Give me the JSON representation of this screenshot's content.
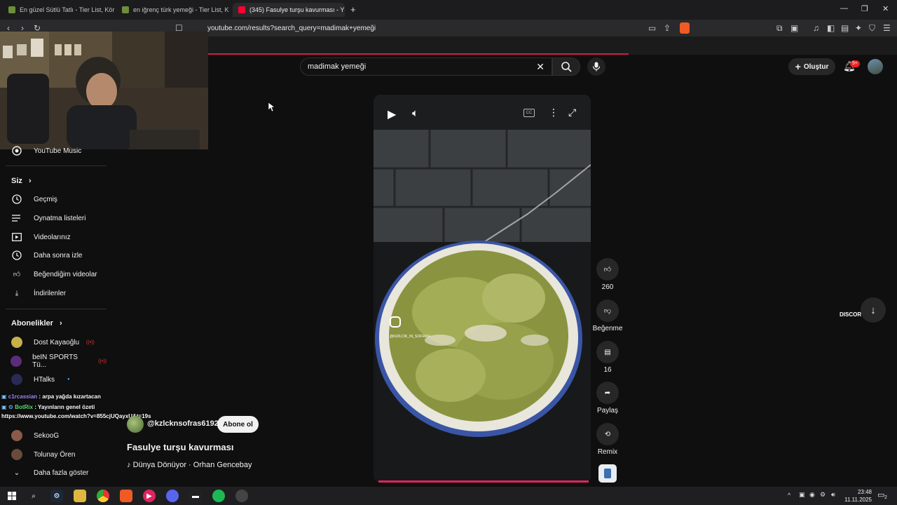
{
  "browser": {
    "tabs": [
      {
        "title": "En güzel Sütlü Tatlı - Tier List, Kör Sır"
      },
      {
        "title": "en iğrenç türk yemeği - Tier List, Kör"
      },
      {
        "title": "(345) Fasulye turşu kavurması - Y"
      }
    ],
    "url": "youtube.com/results?search_query=madimak+yemeği"
  },
  "youtube": {
    "search_value": "madimak yemeği",
    "create_label": "Oluştur",
    "notif_badge": "9+"
  },
  "sidebar": {
    "music_label": "YouTube Music",
    "you_section": "Siz",
    "you_items": [
      {
        "label": "Geçmiş",
        "icon": "history-icon"
      },
      {
        "label": "Oynatma listeleri",
        "icon": "playlist-icon"
      },
      {
        "label": "Videolarınız",
        "icon": "your-videos-icon"
      },
      {
        "label": "Daha sonra izle",
        "icon": "watch-later-icon"
      },
      {
        "label": "Beğendiğim videolar",
        "icon": "thumbs-up-icon"
      },
      {
        "label": "İndirilenler",
        "icon": "download-icon"
      }
    ],
    "subs_section": "Abonelikler",
    "subs": [
      {
        "label": "Dost Kayaoğlu",
        "color": "#c7b24a"
      },
      {
        "label": "beIN SPORTS Tü...",
        "color": "#5a2d7a"
      },
      {
        "label": "HTalks",
        "color": "#2a2a55"
      },
      {
        "label": "SekooG",
        "color": "#8a5a4a"
      },
      {
        "label": "Tolunay Ören",
        "color": "#6a4a3a"
      }
    ],
    "more_label": "Daha fazla göster"
  },
  "short": {
    "channel": "@kzlcknsofras6192",
    "subscribe_label": "Abone ol",
    "title": "Fasulye turşu kavurması",
    "music": "Dünya Dönüyor · Orhan Gencebay",
    "watermark": "@KIZILCIK_IN_SOFRASI"
  },
  "actions": {
    "likes": "260",
    "dislike_label": "Beğenme",
    "comments": "16",
    "share_label": "Paylaş",
    "remix_label": "Remix"
  },
  "overlay": {
    "chat": [
      {
        "user": "c1rcassian",
        "text": "arpa yağda kızartacan"
      },
      {
        "user": "BotRix",
        "text": "Yayınların genel özeti"
      }
    ],
    "link": "https://www.youtube.com/watch?v=855cjUQayxU&t=19s",
    "discord_text": "DISCOR"
  },
  "taskbar": {
    "time": "23:48",
    "date": "11.11.2025",
    "notif_count": "2"
  }
}
